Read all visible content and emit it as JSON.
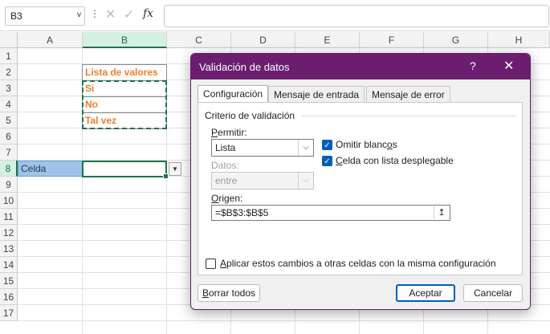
{
  "formula_bar": {
    "name_box": "B3",
    "name_box_arrow": "v",
    "more_icon": "⋮",
    "cancel_icon": "✕",
    "enter_icon": "✓",
    "fx_label": "fx",
    "formula": ""
  },
  "sheet": {
    "columns": [
      "A",
      "B",
      "C",
      "D",
      "E",
      "F",
      "G",
      "H"
    ],
    "rows": [
      "1",
      "2",
      "3",
      "4",
      "5",
      "6",
      "7",
      "8",
      "9",
      "10",
      "11",
      "12",
      "13",
      "14",
      "15",
      "16",
      "17"
    ],
    "selected_column": "B",
    "selected_row": "8",
    "cells": {
      "B2": "Lista de valores",
      "B3": "Si",
      "B4": "No",
      "B5": "Tal vez",
      "A8": "Celda"
    },
    "dropdown_arrow": "▼"
  },
  "dialog": {
    "title": "Validación de datos",
    "help": "?",
    "close": "✕",
    "tabs": [
      "Configuración",
      "Mensaje de entrada",
      "Mensaje de error"
    ],
    "group_title": "Criterio de validación",
    "allow_label": "Permitir:",
    "allow_value": "Lista",
    "data_label": "Datos:",
    "data_value": "entre",
    "ignore_blank_label": "Omitir blancos",
    "in_cell_dropdown_label": "Celda con lista desplegable",
    "source_label": "Origen:",
    "source_value": "=$B$3:$B$5",
    "source_pick_icon": "↥",
    "apply_all_label": "Aplicar estos cambios a otras celdas con la misma configuración",
    "clear_all": "Borrar todos",
    "ok": "Aceptar",
    "cancel": "Cancelar",
    "checkmark": "✓",
    "select_arrow": "⌵",
    "ignore_blank_checked": true,
    "in_cell_dropdown_checked": true,
    "apply_all_checked": false
  },
  "colors": {
    "title_bar": "#6b1e6e",
    "excel_green": "#217346",
    "orange_text": "#ed7d31",
    "selected_cell_fill": "#9dc3e6",
    "checkbox_blue": "#005fb8"
  }
}
